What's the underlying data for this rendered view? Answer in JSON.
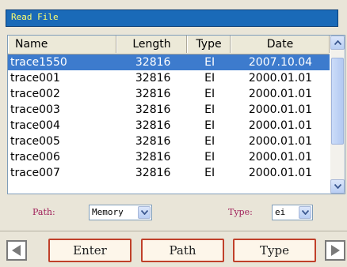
{
  "window": {
    "title": "Read File"
  },
  "table": {
    "columns": [
      "Name",
      "Length",
      "Type",
      "Date"
    ],
    "rows": [
      {
        "name": "trace1550",
        "length": "32816",
        "type": "EI",
        "date": "2007.10.04"
      },
      {
        "name": "trace001",
        "length": "32816",
        "type": "EI",
        "date": "2000.01.01"
      },
      {
        "name": "trace002",
        "length": "32816",
        "type": "EI",
        "date": "2000.01.01"
      },
      {
        "name": "trace003",
        "length": "32816",
        "type": "EI",
        "date": "2000.01.01"
      },
      {
        "name": "trace004",
        "length": "32816",
        "type": "EI",
        "date": "2000.01.01"
      },
      {
        "name": "trace005",
        "length": "32816",
        "type": "EI",
        "date": "2000.01.01"
      },
      {
        "name": "trace006",
        "length": "32816",
        "type": "EI",
        "date": "2000.01.01"
      },
      {
        "name": "trace007",
        "length": "32816",
        "type": "EI",
        "date": "2000.01.01"
      }
    ]
  },
  "path": {
    "label": "Path:",
    "value": "Memory"
  },
  "filter": {
    "label": "Type:",
    "value": "ei"
  },
  "buttons": {
    "enter": "Enter",
    "path": "Path",
    "type": "Type"
  },
  "icons": {
    "scroll_up": "triangle-up-icon",
    "scroll_down": "triangle-down-icon",
    "prev": "triangle-left-icon",
    "next": "triangle-right-icon",
    "dropdown": "chevron-down-icon"
  },
  "colors": {
    "title_bar": "#1a6ab8",
    "title_text": "#ffff70",
    "selected_row": "#3d7bcd",
    "label_text": "#a0205a",
    "button_border": "#c0402a"
  }
}
